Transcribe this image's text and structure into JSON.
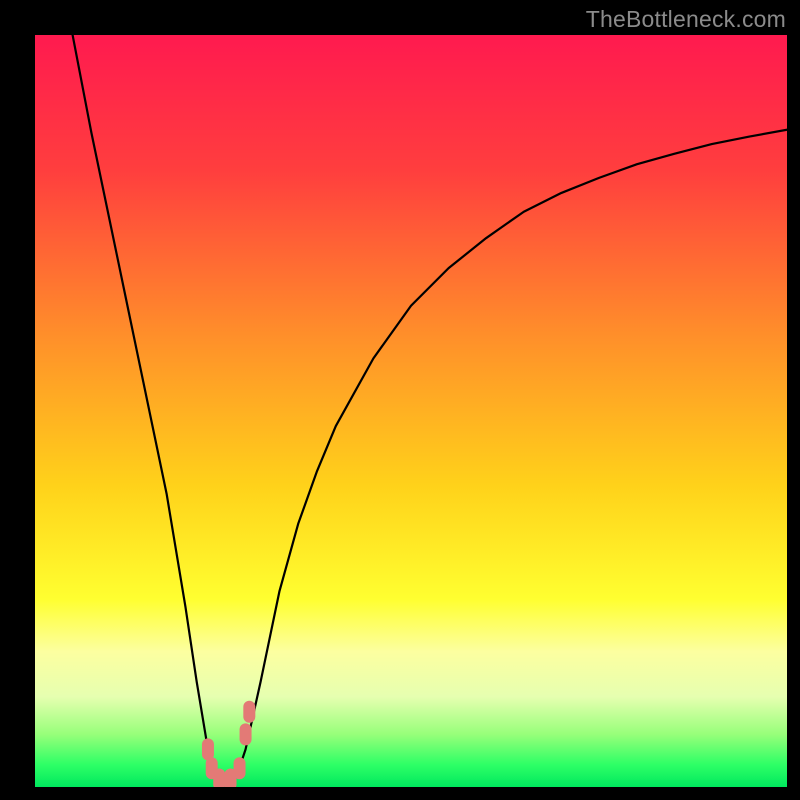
{
  "watermark": "TheBottleneck.com",
  "colors": {
    "frame": "#000000",
    "curve": "#000000",
    "marker": "#e37a76",
    "gradient_stops": [
      {
        "pct": 0,
        "color": "#ff1a4f"
      },
      {
        "pct": 18,
        "color": "#ff3e3e"
      },
      {
        "pct": 40,
        "color": "#ff8f2a"
      },
      {
        "pct": 60,
        "color": "#ffd21a"
      },
      {
        "pct": 75,
        "color": "#ffff30"
      },
      {
        "pct": 82,
        "color": "#fcffa0"
      },
      {
        "pct": 88,
        "color": "#e6ffb0"
      },
      {
        "pct": 93,
        "color": "#97ff7a"
      },
      {
        "pct": 97,
        "color": "#2eff66"
      },
      {
        "pct": 100,
        "color": "#00e85e"
      }
    ]
  },
  "chart_data": {
    "type": "line",
    "title": "",
    "xlabel": "",
    "ylabel": "",
    "xlim": [
      0,
      100
    ],
    "ylim": [
      0,
      100
    ],
    "grid": false,
    "series": [
      {
        "name": "bottleneck-curve",
        "x": [
          5,
          7.5,
          10,
          12.5,
          15,
          17.5,
          20,
          21.5,
          23,
          24,
          25,
          26,
          27,
          28,
          30,
          32.5,
          35,
          37.5,
          40,
          45,
          50,
          55,
          60,
          65,
          70,
          75,
          80,
          85,
          90,
          95,
          100
        ],
        "y": [
          100,
          87,
          75,
          63,
          51,
          39,
          24,
          14,
          5,
          2,
          1,
          1,
          2,
          5,
          14,
          26,
          35,
          42,
          48,
          57,
          64,
          69,
          73,
          76.5,
          79,
          81,
          82.8,
          84.2,
          85.5,
          86.5,
          87.4
        ]
      }
    ],
    "markers": [
      {
        "x": 23,
        "y": 5
      },
      {
        "x": 23.5,
        "y": 2.5
      },
      {
        "x": 24.5,
        "y": 1
      },
      {
        "x": 26,
        "y": 1
      },
      {
        "x": 27.2,
        "y": 2.5
      },
      {
        "x": 28,
        "y": 7
      },
      {
        "x": 28.5,
        "y": 10
      }
    ]
  }
}
